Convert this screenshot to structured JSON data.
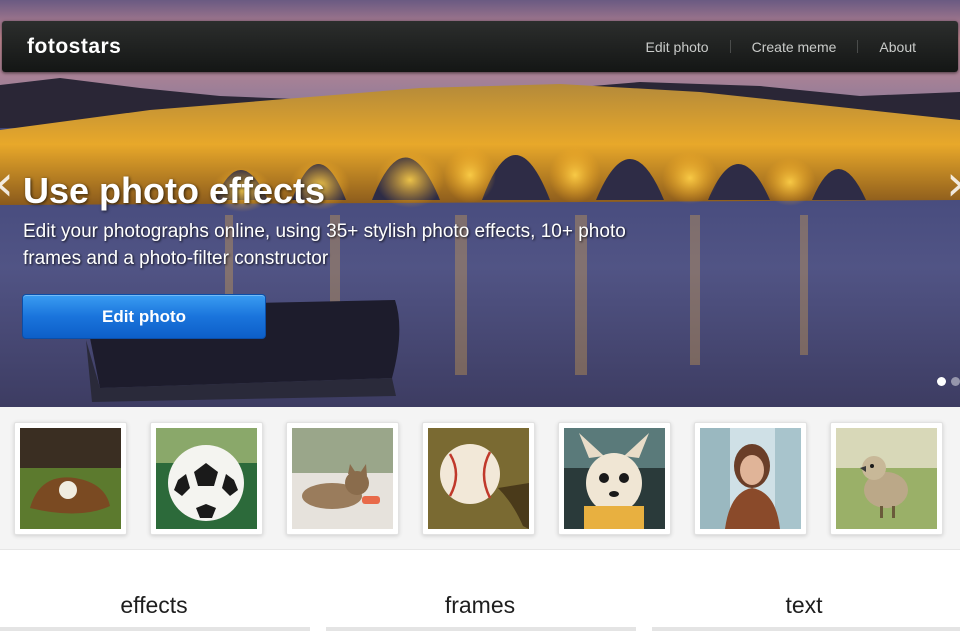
{
  "navbar": {
    "brand": "fotostars",
    "links": [
      {
        "label": "Edit photo"
      },
      {
        "label": "Create meme"
      },
      {
        "label": "About"
      }
    ]
  },
  "hero": {
    "title": "Use photo effects",
    "description": "Edit your photographs online, using 35+ stylish photo effects, 10+ photo frames and a photo-filter constructor",
    "cta_label": "Edit photo",
    "prev_icon": "chevron-left-icon",
    "next_icon": "chevron-right-icon",
    "slides_total": 2,
    "active_slide": 1
  },
  "thumbnails": [
    {
      "subject": "baseball-glove"
    },
    {
      "subject": "soccer-ball"
    },
    {
      "subject": "cat"
    },
    {
      "subject": "baseball"
    },
    {
      "subject": "chihuahua"
    },
    {
      "subject": "woman"
    },
    {
      "subject": "duckling"
    }
  ],
  "features": [
    {
      "label": "effects"
    },
    {
      "label": "frames"
    },
    {
      "label": "text"
    }
  ],
  "colors": {
    "navbar": "#1f2120",
    "cta": "#1a74dc",
    "strip_bg": "#f4f4f4"
  }
}
